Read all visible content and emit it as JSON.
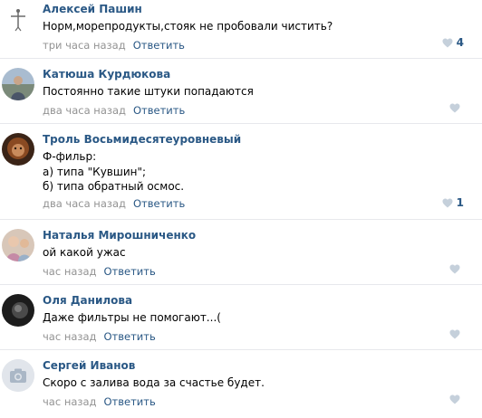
{
  "comments": [
    {
      "author": "Алексей Пашин",
      "lines": [
        "Норм,морепродукты,стояк не пробовали чистить?"
      ],
      "time": "три часа назад",
      "reply": "Ответить",
      "likes": "4",
      "avatar": "gray-figure"
    },
    {
      "author": "Катюша Курдюкова",
      "lines": [
        "Постоянно такие штуки попадаются"
      ],
      "time": "два часа назад",
      "reply": "Ответить",
      "likes": "",
      "avatar": "photo-landscape"
    },
    {
      "author": "Троль Восьмидесятеуровневый",
      "lines": [
        "Ф-фильр:",
        "а) типа \"Кувшин\";",
        "б) типа обратный осмос."
      ],
      "time": "два часа назад",
      "reply": "Ответить",
      "likes": "1",
      "avatar": "photo-orangutan"
    },
    {
      "author": "Наталья Мирошниченко",
      "lines": [
        "ой какой ужас"
      ],
      "time": "час назад",
      "reply": "Ответить",
      "likes": "",
      "avatar": "photo-people"
    },
    {
      "author": "Оля Данилова",
      "lines": [
        "Даже фильтры не помогают...("
      ],
      "time": "час назад",
      "reply": "Ответить",
      "likes": "",
      "avatar": "photo-dark"
    },
    {
      "author": "Сергей Иванов",
      "lines": [
        "Скоро с залива вода за счастье будет."
      ],
      "time": "час назад",
      "reply": "Ответить",
      "likes": "",
      "avatar": "camera-placeholder"
    }
  ],
  "colors": {
    "link": "#2a5885",
    "muted": "#939393",
    "heart_inactive": "#c5d0db",
    "divider": "#e7e8ec"
  }
}
